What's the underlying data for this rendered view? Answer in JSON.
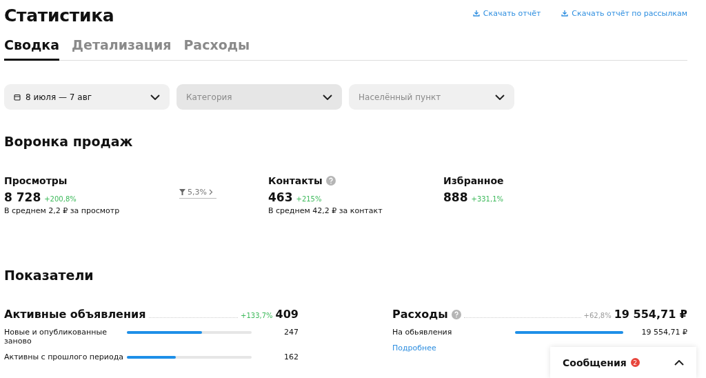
{
  "title": "Статистика",
  "downloads": [
    "Скачать отчёт",
    "Скачать отчёт по рассылкам"
  ],
  "tabs": [
    {
      "label": "Сводка",
      "selected": true
    },
    {
      "label": "Детализация",
      "selected": false
    },
    {
      "label": "Расходы",
      "selected": false
    }
  ],
  "filters": [
    {
      "value": "8 июля — 7 авг",
      "kind": "date"
    },
    {
      "placeholder": "Категория",
      "kind": "select"
    },
    {
      "placeholder": "Населённый пункт",
      "kind": "select"
    }
  ],
  "funnel": {
    "title": "Воронка продаж",
    "conversion": "5,3%",
    "steps": [
      {
        "label": "Просмотры",
        "value": "8 728",
        "change": "+200,8%",
        "note": "В среднем 2,2 ₽ за просмотр",
        "help": false
      },
      {
        "label": "Контакты",
        "value": "463",
        "change": "+215%",
        "note": "В среднем 42,2 ₽ за контакт",
        "help": true
      },
      {
        "label": "Избранное",
        "value": "888",
        "change": "+331,1%",
        "help": false
      }
    ]
  },
  "indicators": {
    "title": "Показатели",
    "blocks": [
      {
        "title": "Активные объявления",
        "help": false,
        "change": "+133,7%",
        "highlight": true,
        "total": "409",
        "rows": [
          {
            "label": "Новые и опубликованные заново",
            "level": 0.6,
            "value": "247"
          },
          {
            "label": "Активны с прошлого периода",
            "level": 0.39,
            "value": "162"
          }
        ]
      },
      {
        "title": "Расходы",
        "help": true,
        "change": "+62,8%",
        "highlight": false,
        "total": "19 554,71 ₽",
        "rows": [
          {
            "label": "На обьявления",
            "level": 1,
            "value": "19 554,71 ₽"
          }
        ],
        "link": "Подробнее"
      }
    ]
  },
  "messages": {
    "title": "Сообщения",
    "badge": "2"
  }
}
